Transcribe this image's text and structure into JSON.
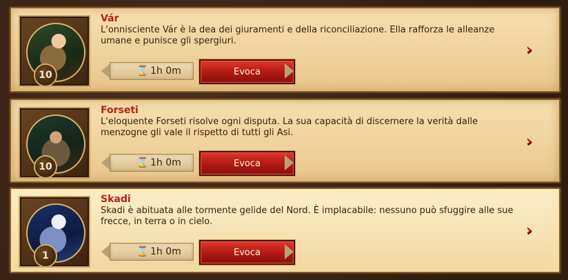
{
  "cards": [
    {
      "name": "Vár",
      "description": "L'onnisciente Vár è la dea dei giuramenti e della riconciliazione. Ella rafforza le alleanze umane e punisce gli spergiuri.",
      "level": "10",
      "time": "1h 0m",
      "button": "Evoca"
    },
    {
      "name": "Forseti",
      "description": "L'eloquente Forseti risolve ogni disputa. La sua capacità di discernere la verità dalle menzogne gli vale il rispetto di tutti gli Asi.",
      "level": "10",
      "time": "1h 0m",
      "button": "Evoca"
    },
    {
      "name": "Skadi",
      "description": "Skadi è abituata alle tormente gelide del Nord. È implacabile: nessuno può sfuggire alle sue frecce, in terra o in cielo.",
      "level": "1",
      "time": "1h 0m",
      "button": "Evoca"
    }
  ],
  "icons": {
    "next": "chevron-right-icon",
    "timer": "hourglass-icon"
  }
}
